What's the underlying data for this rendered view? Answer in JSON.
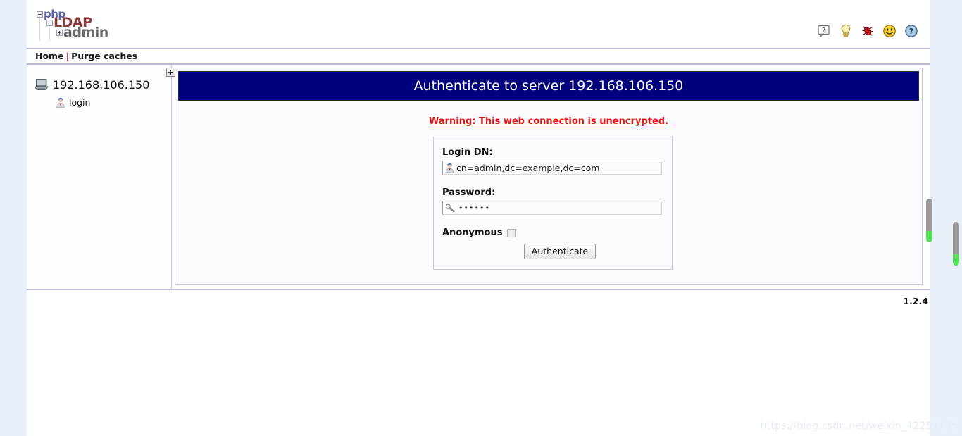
{
  "app": {
    "logo": {
      "part1": "php",
      "part2": "LDAP",
      "part3": "admin"
    },
    "version": "1.2.4"
  },
  "top_icons": [
    {
      "name": "question-bubble-icon",
      "title": "?"
    },
    {
      "name": "lightbulb-icon",
      "title": "Hint"
    },
    {
      "name": "bug-icon",
      "title": "Report a bug"
    },
    {
      "name": "smiley-icon",
      "title": "Smile"
    },
    {
      "name": "help-icon",
      "title": "Help"
    }
  ],
  "menubar": {
    "home": "Home",
    "separator": "|",
    "purge_caches": "Purge caches"
  },
  "sidebar": {
    "expand_box": "+",
    "server": {
      "icon": "server-icon",
      "label": "192.168.106.150"
    },
    "children": [
      {
        "icon": "user-icon",
        "label": "login"
      }
    ]
  },
  "main": {
    "panel_title": "Authenticate to server 192.168.106.150",
    "warning": "Warning: This web connection is unencrypted.",
    "form": {
      "login_dn": {
        "label": "Login DN:",
        "value": "cn=admin,dc=example,dc=com",
        "placeholder": "cn=admin,dc=example,dc=com",
        "icon": "user-icon"
      },
      "password": {
        "label": "Password:",
        "value": "••••••",
        "placeholder": "",
        "icon": "key-icon"
      },
      "anonymous": {
        "label": "Anonymous",
        "checked": false
      },
      "submit_label": "Authenticate"
    }
  },
  "watermark": "https://blog.csdn.net/weixin_42257195",
  "colors": {
    "panel_header": "#00007c",
    "warning": "#e81313",
    "logo_php": "#5a5fa8",
    "logo_ldap": "#8b3a3a",
    "logo_admin": "#6b6b6b",
    "page_margin": "#eaf0f9",
    "scrollbar_accent": "#55e25b"
  }
}
